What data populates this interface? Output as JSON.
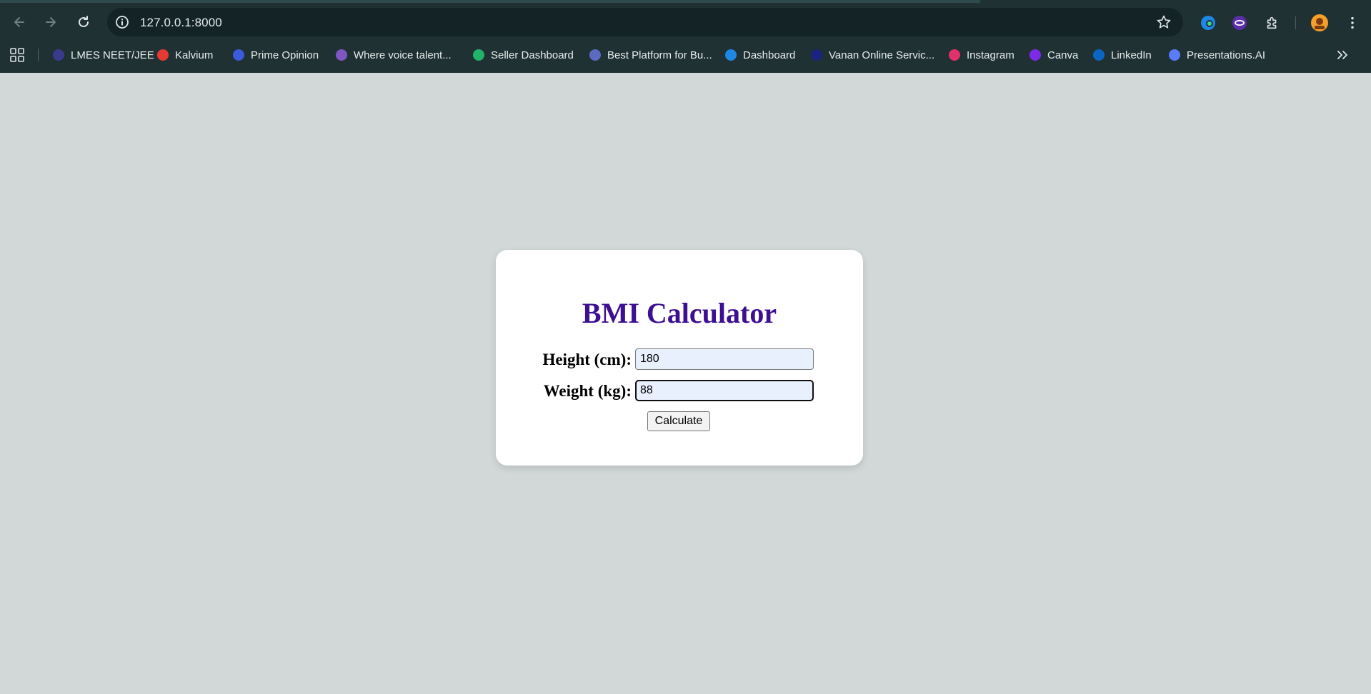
{
  "browser": {
    "url": "127.0.0.1:8000",
    "bookmarks": [
      {
        "label": "LMES NEET/JEE",
        "icon": "lmes-favicon-icon",
        "color": "#3a3a8c"
      },
      {
        "label": "Kalvium",
        "icon": "kalvium-favicon-icon",
        "color": "#e53935"
      },
      {
        "label": "Prime Opinion",
        "icon": "prime-opinion-favicon-icon",
        "color": "#3b5bdb"
      },
      {
        "label": "Where voice talent...",
        "icon": "voice-favicon-icon",
        "color": "#7e57c2"
      },
      {
        "label": "Seller Dashboard",
        "icon": "seller-favicon-icon",
        "color": "#22b36b"
      },
      {
        "label": "Best Platform for Bu...",
        "icon": "platform-favicon-icon",
        "color": "#5c6bc0"
      },
      {
        "label": "Dashboard",
        "icon": "dashboard-favicon-icon",
        "color": "#1e88e5"
      },
      {
        "label": "Vanan Online Servic...",
        "icon": "vanan-favicon-icon",
        "color": "#1a237e"
      },
      {
        "label": "Instagram",
        "icon": "instagram-favicon-icon",
        "color": "#e1306c"
      },
      {
        "label": "Canva",
        "icon": "canva-favicon-icon",
        "color": "#7d2ae8"
      },
      {
        "label": "LinkedIn",
        "icon": "linkedin-favicon-icon",
        "color": "#0a66c2"
      },
      {
        "label": "Presentations.AI",
        "icon": "presentations-favicon-icon",
        "color": "#5b7cfa"
      }
    ]
  },
  "app": {
    "title": "BMI Calculator",
    "height_label": "Height (cm):",
    "height_value": "180",
    "weight_label": "Weight (kg):",
    "weight_value": "88",
    "calculate_label": "Calculate"
  },
  "colors": {
    "page_background": "#d2d8d8",
    "title": "#3d0f91",
    "chrome": "#1f3133"
  }
}
